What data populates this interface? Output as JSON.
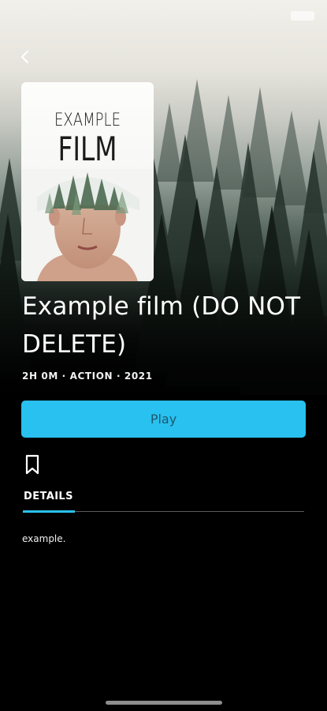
{
  "film": {
    "title": "Example film (DO NOT DELETE)",
    "meta": "2H 0M · ACTION · 2021",
    "description": "example."
  },
  "poster": {
    "line1": "EXAMPLE",
    "line2": "FILM"
  },
  "actions": {
    "play_label": "Play"
  },
  "tabs": [
    {
      "label": "DETAILS",
      "active": true
    }
  ],
  "colors": {
    "accent": "#29c1ef",
    "background": "#000000"
  },
  "icons": {
    "back": "chevron-left-icon",
    "bookmark": "bookmark-icon"
  }
}
